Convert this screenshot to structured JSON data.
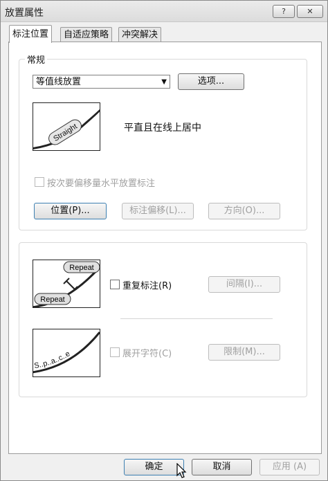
{
  "window": {
    "title": "放置属性",
    "help_glyph": "?",
    "close_glyph": "✕"
  },
  "tabs": [
    {
      "label": "标注位置",
      "active": true
    },
    {
      "label": "自适应策略",
      "active": false
    },
    {
      "label": "冲突解决",
      "active": false
    }
  ],
  "general": {
    "legend": "常规",
    "placement_select": "等值线放置",
    "options_button": "选项...",
    "preview_word": "Straight",
    "placement_desc": "平直且在线上居中",
    "offset_checkbox_label": "按次要偏移量水平放置标注",
    "position_button": "位置(P)...",
    "label_offset_button": "标注偏移(L)...",
    "direction_button": "方向(O)..."
  },
  "repeat": {
    "preview_word_top": "Repeat",
    "preview_word_bottom": "Repeat",
    "checkbox_label": "重复标注(R)",
    "interval_button": "间隔(I)..."
  },
  "spread": {
    "preview_text": "S..p..a..c..e",
    "checkbox_label": "展开字符(C)",
    "limit_button": "限制(M)..."
  },
  "footer": {
    "ok": "确定",
    "cancel": "取消",
    "apply": "应用 (A)"
  },
  "colors": {
    "window_bg": "#f0f0f0",
    "panel_bg": "#ffffff",
    "disabled_text": "#a0a0a0"
  }
}
